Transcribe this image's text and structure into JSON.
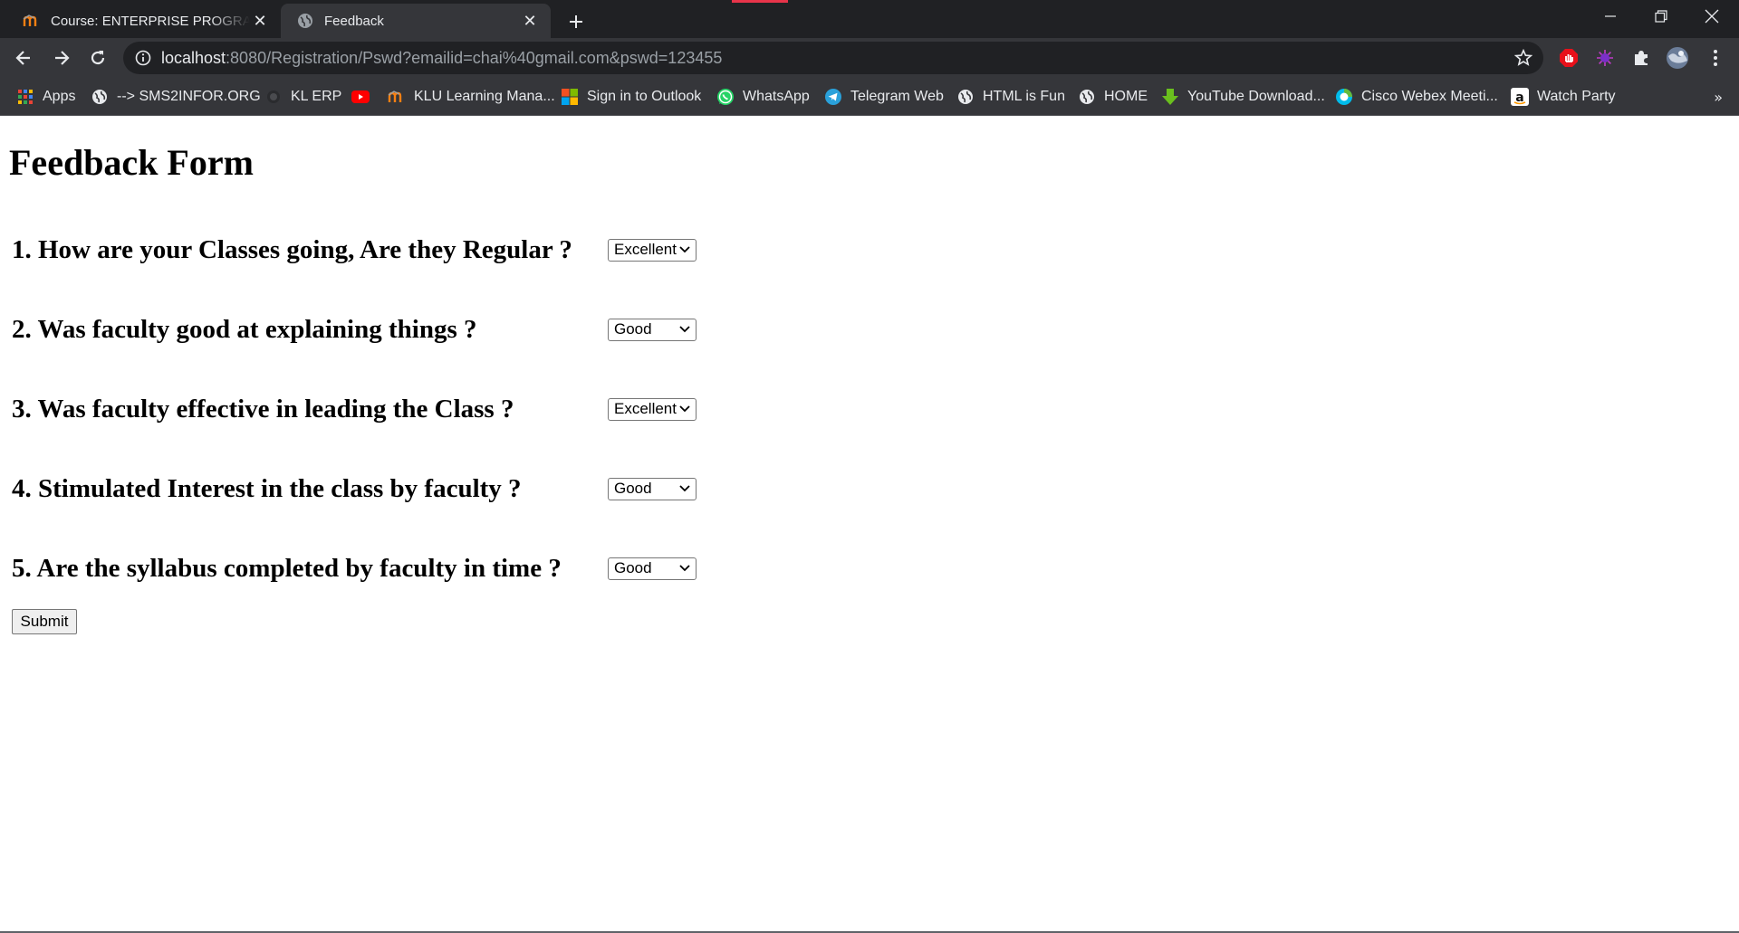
{
  "tabs": [
    {
      "title": "Course: ENTERPRISE PROGRAMMING",
      "favicon": "moodle-icon",
      "active": false
    },
    {
      "title": "Feedback",
      "favicon": "globe-icon",
      "active": true
    }
  ],
  "toolbar": {
    "url_host": "localhost",
    "url_rest": ":8080/Registration/Pswd?emailid=chai%40gmail.com&pswd=123455"
  },
  "bookmarks": [
    {
      "label": "Apps",
      "icon": "apps-grid-icon"
    },
    {
      "label": "--> SMS2INFOR.ORG",
      "icon": "globe-icon"
    },
    {
      "label": "KL ERP",
      "icon": "erp-icon"
    },
    {
      "label": "",
      "icon": "youtube-icon"
    },
    {
      "label": "KLU Learning Mana...",
      "icon": "moodle-icon"
    },
    {
      "label": "Sign in to Outlook",
      "icon": "microsoft-icon"
    },
    {
      "label": "WhatsApp",
      "icon": "whatsapp-icon"
    },
    {
      "label": "Telegram Web",
      "icon": "telegram-icon"
    },
    {
      "label": "HTML is Fun",
      "icon": "globe-icon"
    },
    {
      "label": "HOME",
      "icon": "globe-icon"
    },
    {
      "label": "YouTube Download...",
      "icon": "download-arrow-icon"
    },
    {
      "label": "Cisco Webex Meeti...",
      "icon": "webex-icon"
    },
    {
      "label": "Watch Party",
      "icon": "amazon-icon"
    }
  ],
  "bookmarks_more": "»",
  "page": {
    "heading": "Feedback Form",
    "questions": [
      {
        "text": "1. How are your Classes going, Are they Regular ?",
        "selected": "Excellent"
      },
      {
        "text": "2. Was faculty good at explaining things ?",
        "selected": "Good"
      },
      {
        "text": "3. Was faculty effective in leading the Class ?",
        "selected": "Excellent"
      },
      {
        "text": "4. Stimulated Interest in the class by faculty ?",
        "selected": "Good"
      },
      {
        "text": "5. Are the syllabus completed by faculty in time ?",
        "selected": "Good"
      }
    ],
    "submit_label": "Submit"
  },
  "colors": {
    "tabstrip_bg": "#202124",
    "toolbar_bg": "#35363a",
    "omnibox_bg": "#202124",
    "text_light": "#e8eaed",
    "text_dim": "#9aa0a6"
  }
}
